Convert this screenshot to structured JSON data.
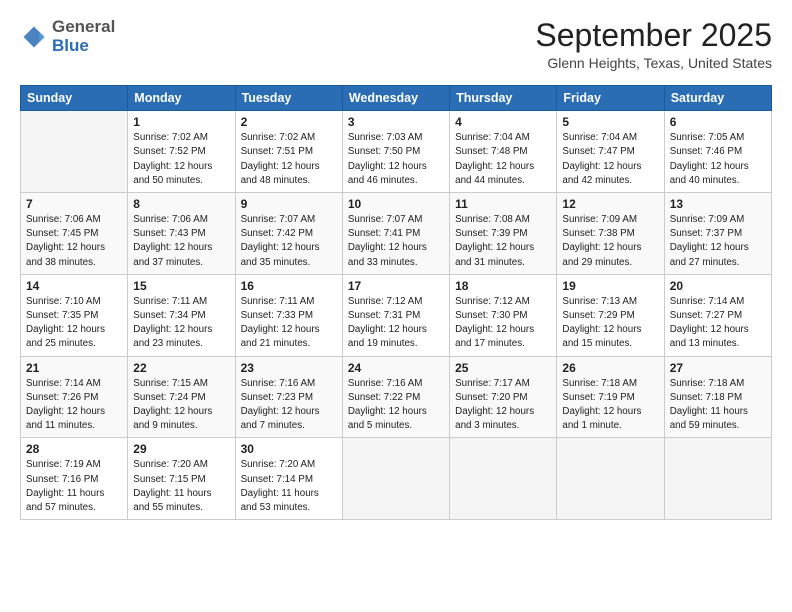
{
  "logo": {
    "general": "General",
    "blue": "Blue"
  },
  "header": {
    "title": "September 2025",
    "subtitle": "Glenn Heights, Texas, United States"
  },
  "days_of_week": [
    "Sunday",
    "Monday",
    "Tuesday",
    "Wednesday",
    "Thursday",
    "Friday",
    "Saturday"
  ],
  "weeks": [
    [
      {
        "day": "",
        "info": ""
      },
      {
        "day": "1",
        "info": "Sunrise: 7:02 AM\nSunset: 7:52 PM\nDaylight: 12 hours\nand 50 minutes."
      },
      {
        "day": "2",
        "info": "Sunrise: 7:02 AM\nSunset: 7:51 PM\nDaylight: 12 hours\nand 48 minutes."
      },
      {
        "day": "3",
        "info": "Sunrise: 7:03 AM\nSunset: 7:50 PM\nDaylight: 12 hours\nand 46 minutes."
      },
      {
        "day": "4",
        "info": "Sunrise: 7:04 AM\nSunset: 7:48 PM\nDaylight: 12 hours\nand 44 minutes."
      },
      {
        "day": "5",
        "info": "Sunrise: 7:04 AM\nSunset: 7:47 PM\nDaylight: 12 hours\nand 42 minutes."
      },
      {
        "day": "6",
        "info": "Sunrise: 7:05 AM\nSunset: 7:46 PM\nDaylight: 12 hours\nand 40 minutes."
      }
    ],
    [
      {
        "day": "7",
        "info": "Sunrise: 7:06 AM\nSunset: 7:45 PM\nDaylight: 12 hours\nand 38 minutes."
      },
      {
        "day": "8",
        "info": "Sunrise: 7:06 AM\nSunset: 7:43 PM\nDaylight: 12 hours\nand 37 minutes."
      },
      {
        "day": "9",
        "info": "Sunrise: 7:07 AM\nSunset: 7:42 PM\nDaylight: 12 hours\nand 35 minutes."
      },
      {
        "day": "10",
        "info": "Sunrise: 7:07 AM\nSunset: 7:41 PM\nDaylight: 12 hours\nand 33 minutes."
      },
      {
        "day": "11",
        "info": "Sunrise: 7:08 AM\nSunset: 7:39 PM\nDaylight: 12 hours\nand 31 minutes."
      },
      {
        "day": "12",
        "info": "Sunrise: 7:09 AM\nSunset: 7:38 PM\nDaylight: 12 hours\nand 29 minutes."
      },
      {
        "day": "13",
        "info": "Sunrise: 7:09 AM\nSunset: 7:37 PM\nDaylight: 12 hours\nand 27 minutes."
      }
    ],
    [
      {
        "day": "14",
        "info": "Sunrise: 7:10 AM\nSunset: 7:35 PM\nDaylight: 12 hours\nand 25 minutes."
      },
      {
        "day": "15",
        "info": "Sunrise: 7:11 AM\nSunset: 7:34 PM\nDaylight: 12 hours\nand 23 minutes."
      },
      {
        "day": "16",
        "info": "Sunrise: 7:11 AM\nSunset: 7:33 PM\nDaylight: 12 hours\nand 21 minutes."
      },
      {
        "day": "17",
        "info": "Sunrise: 7:12 AM\nSunset: 7:31 PM\nDaylight: 12 hours\nand 19 minutes."
      },
      {
        "day": "18",
        "info": "Sunrise: 7:12 AM\nSunset: 7:30 PM\nDaylight: 12 hours\nand 17 minutes."
      },
      {
        "day": "19",
        "info": "Sunrise: 7:13 AM\nSunset: 7:29 PM\nDaylight: 12 hours\nand 15 minutes."
      },
      {
        "day": "20",
        "info": "Sunrise: 7:14 AM\nSunset: 7:27 PM\nDaylight: 12 hours\nand 13 minutes."
      }
    ],
    [
      {
        "day": "21",
        "info": "Sunrise: 7:14 AM\nSunset: 7:26 PM\nDaylight: 12 hours\nand 11 minutes."
      },
      {
        "day": "22",
        "info": "Sunrise: 7:15 AM\nSunset: 7:24 PM\nDaylight: 12 hours\nand 9 minutes."
      },
      {
        "day": "23",
        "info": "Sunrise: 7:16 AM\nSunset: 7:23 PM\nDaylight: 12 hours\nand 7 minutes."
      },
      {
        "day": "24",
        "info": "Sunrise: 7:16 AM\nSunset: 7:22 PM\nDaylight: 12 hours\nand 5 minutes."
      },
      {
        "day": "25",
        "info": "Sunrise: 7:17 AM\nSunset: 7:20 PM\nDaylight: 12 hours\nand 3 minutes."
      },
      {
        "day": "26",
        "info": "Sunrise: 7:18 AM\nSunset: 7:19 PM\nDaylight: 12 hours\nand 1 minute."
      },
      {
        "day": "27",
        "info": "Sunrise: 7:18 AM\nSunset: 7:18 PM\nDaylight: 11 hours\nand 59 minutes."
      }
    ],
    [
      {
        "day": "28",
        "info": "Sunrise: 7:19 AM\nSunset: 7:16 PM\nDaylight: 11 hours\nand 57 minutes."
      },
      {
        "day": "29",
        "info": "Sunrise: 7:20 AM\nSunset: 7:15 PM\nDaylight: 11 hours\nand 55 minutes."
      },
      {
        "day": "30",
        "info": "Sunrise: 7:20 AM\nSunset: 7:14 PM\nDaylight: 11 hours\nand 53 minutes."
      },
      {
        "day": "",
        "info": ""
      },
      {
        "day": "",
        "info": ""
      },
      {
        "day": "",
        "info": ""
      },
      {
        "day": "",
        "info": ""
      }
    ]
  ]
}
